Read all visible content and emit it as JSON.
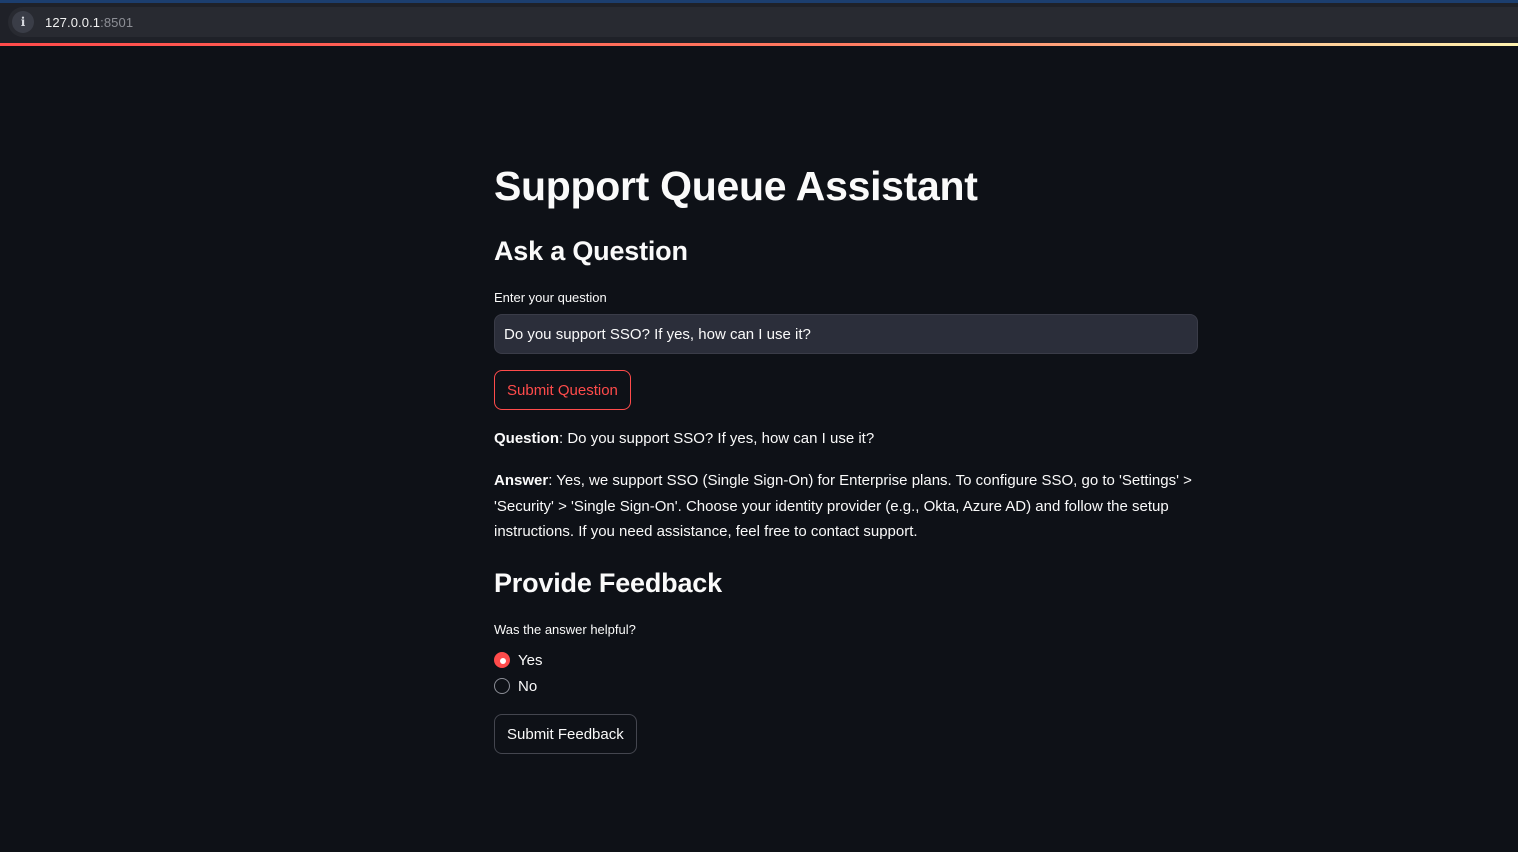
{
  "browser": {
    "url_host": "127.0.0.1",
    "url_port": ":8501"
  },
  "app": {
    "title": "Support Queue Assistant"
  },
  "ask": {
    "heading": "Ask a Question",
    "input_label": "Enter your question",
    "input_value": "Do you support SSO? If yes, how can I use it?",
    "submit_label": "Submit Question"
  },
  "result": {
    "question_label": "Question",
    "question_text": ": Do you support SSO? If yes, how can I use it?",
    "answer_label": "Answer",
    "answer_text": ": Yes, we support SSO (Single Sign-On) for Enterprise plans. To configure SSO, go to 'Settings' > 'Security' > 'Single Sign-On'. Choose your identity provider (e.g., Okta, Azure AD) and follow the setup instructions. If you need assistance, feel free to contact support."
  },
  "feedback": {
    "heading": "Provide Feedback",
    "radio_label": "Was the answer helpful?",
    "options": [
      {
        "label": "Yes",
        "selected": true
      },
      {
        "label": "No",
        "selected": false
      }
    ],
    "submit_label": "Submit Feedback"
  },
  "colors": {
    "background": "#0e1117",
    "accent": "#ff4b4b",
    "input_bg": "#2b2e3a"
  }
}
